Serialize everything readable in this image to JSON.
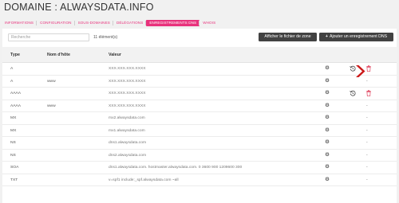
{
  "page": {
    "title": "DOMAINE : ALWAYSDATA.INFO"
  },
  "tabs": [
    {
      "label": "INFORMATIONS",
      "active": false
    },
    {
      "label": "CONFIGURATION",
      "active": false
    },
    {
      "label": "SOUS-DOMAINES",
      "active": false
    },
    {
      "label": "DÉLÉGATIONS",
      "active": false
    },
    {
      "label": "ENREGISTREMENTS DNS",
      "active": true
    },
    {
      "label": "WHOIS",
      "active": false
    }
  ],
  "toolbar": {
    "search_placeholder": "Recherche",
    "count": "11 élément(s)",
    "zone_button": "Afficher le fichier de zone",
    "add_button_icon": "plus-icon",
    "add_button": "Ajouter un enregistrement DNS"
  },
  "table": {
    "headers": {
      "type": "Type",
      "host": "Nom d'hôte",
      "value": "Valeur"
    },
    "rows": [
      {
        "type": "A",
        "host": "",
        "value": "XXX.XXX.XXX.XXXX",
        "actions": "restore-delete"
      },
      {
        "type": "A",
        "host": "www",
        "value": "XXX.XXX.XXX.XXXX",
        "actions": "dash"
      },
      {
        "type": "AAAA",
        "host": "",
        "value": "XXX.XXX.XXX.XXXX",
        "actions": "restore-delete"
      },
      {
        "type": "AAAA",
        "host": "www",
        "value": "XXX.XXX.XXX.XXXX",
        "actions": "dash"
      },
      {
        "type": "MX",
        "host": "",
        "value": "mx2.alwaysdata.com",
        "actions": "dash"
      },
      {
        "type": "MX",
        "host": "",
        "value": "mx1.alwaysdata.com",
        "actions": "dash"
      },
      {
        "type": "NS",
        "host": "",
        "value": "dns1.alwaysdata.com",
        "actions": "dash"
      },
      {
        "type": "NS",
        "host": "",
        "value": "dns2.alwaysdata.com",
        "actions": "dash"
      },
      {
        "type": "SOA",
        "host": "",
        "value": "dns1.alwaysdata.com. hostmaster.alwaysdata.com. 0 3600 900 1209600 300",
        "actions": "dash"
      },
      {
        "type": "TXT",
        "host": "",
        "value": "v=spf1 include:_spf.alwaysdata.com ~all",
        "actions": "dash"
      }
    ],
    "dash_text": "-",
    "icons": {
      "settings": "gear-icon",
      "restore": "restore-icon",
      "delete": "trash-icon"
    }
  },
  "colors": {
    "accent": "#e8327c",
    "button_bg": "#424242",
    "delete": "#e0445f",
    "arrow": "#cc1a1a"
  }
}
